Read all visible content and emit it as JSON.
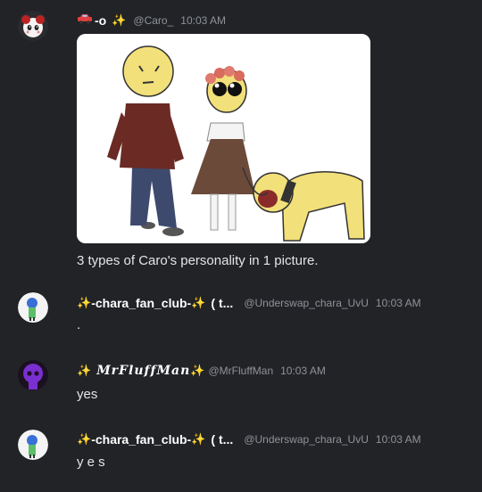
{
  "messages": [
    {
      "username": "-o",
      "handle": "@Caro_",
      "time": "10:03 AM",
      "text": "3 types of Caro's personality in 1 picture."
    },
    {
      "username": "-chara_fan_club-",
      "username_suffix": "( t...",
      "handle": "@Underswap_chara_UvU",
      "time": "10:03 AM",
      "text": "."
    },
    {
      "username": "MrFluffMan",
      "handle": "@MrFluffMan",
      "time": "10:03 AM",
      "text": "yes"
    },
    {
      "username": "-chara_fan_club-",
      "username_suffix": "( t...",
      "handle": "@Underswap_chara_UvU",
      "time": "10:03 AM",
      "text": "y e s"
    }
  ],
  "colors": {
    "background": "#222327",
    "username": "#ffffff",
    "meta": "#8e9297",
    "sparkle": "#ffd866"
  }
}
